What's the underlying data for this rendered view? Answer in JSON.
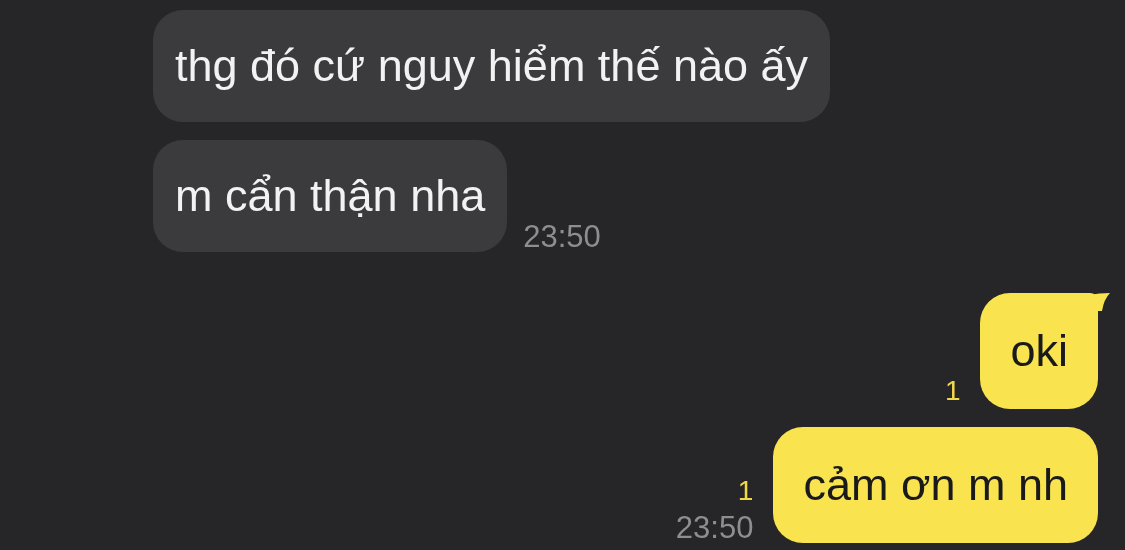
{
  "messages": [
    {
      "kind": "received",
      "text": "thg đó cứ nguy hiểm thế nào ấy"
    },
    {
      "kind": "received",
      "text": "m cẩn thận nha",
      "time": "23:50"
    },
    {
      "kind": "sent",
      "text": "oki",
      "unread": "1",
      "tail": true
    },
    {
      "kind": "sent",
      "text": "cảm ơn m nh",
      "unread": "1",
      "time": "23:50",
      "tail": false
    }
  ]
}
